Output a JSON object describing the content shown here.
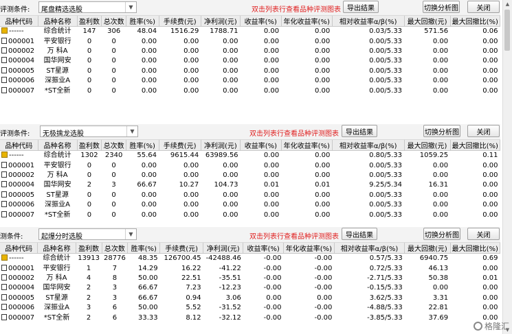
{
  "columns": [
    "品种代码",
    "品种名称",
    "盈利数",
    "总次数",
    "胜率(%)",
    "手续费(元)",
    "净利润(元)",
    "收益率(%)",
    "年化收益率(%)",
    "相对收益率α/β(%)",
    "最大回撤(元)",
    "最大回撤比(%)"
  ],
  "panels": [
    {
      "label": "评测条件:",
      "combo_value": "尾盘精选选股",
      "hint": "双击列表行查看品种评测图表",
      "export_label": "导出结果",
      "switch_label": "切换分析图",
      "close_label": "关闭",
      "rows": [
        [
          "------",
          "综合统计",
          "147",
          "306",
          "48.04",
          "1516.29",
          "1788.71",
          "0.00",
          "0.00",
          "0.03/5.33",
          "571.56",
          "0.06"
        ],
        [
          "000001",
          "平安银行",
          "0",
          "0",
          "0.00",
          "0.00",
          "0.00",
          "0.00",
          "0.00",
          "0.00/5.33",
          "0.00",
          "0.00"
        ],
        [
          "000002",
          "万 科A",
          "0",
          "0",
          "0.00",
          "0.00",
          "0.00",
          "0.00",
          "0.00",
          "0.00/5.33",
          "0.00",
          "0.00"
        ],
        [
          "000004",
          "国华网安",
          "0",
          "0",
          "0.00",
          "0.00",
          "0.00",
          "0.00",
          "0.00",
          "0.00/5.33",
          "0.00",
          "0.00"
        ],
        [
          "000005",
          "ST星源",
          "0",
          "0",
          "0.00",
          "0.00",
          "0.00",
          "0.00",
          "0.00",
          "0.00/5.33",
          "0.00",
          "0.00"
        ],
        [
          "000006",
          "深振业A",
          "0",
          "0",
          "0.00",
          "0.00",
          "0.00",
          "0.00",
          "0.00",
          "0.00/5.33",
          "0.00",
          "0.00"
        ],
        [
          "000007",
          "*ST全新",
          "0",
          "0",
          "0.00",
          "0.00",
          "0.00",
          "0.00",
          "0.00",
          "0.00/5.33",
          "0.00",
          "0.00"
        ]
      ]
    },
    {
      "label": "评测条件:",
      "combo_value": "无极擒龙选股",
      "hint": "双击列表行查看品种评测图表",
      "export_label": "导出结果",
      "switch_label": "切换分析图",
      "close_label": "关闭",
      "rows": [
        [
          "------",
          "综合统计",
          "1302",
          "2340",
          "55.64",
          "9615.44",
          "63989.56",
          "0.00",
          "0.00",
          "0.80/5.33",
          "1059.25",
          "0.11"
        ],
        [
          "000001",
          "平安银行",
          "0",
          "0",
          "0.00",
          "0.00",
          "0.00",
          "0.00",
          "0.00",
          "0.00/5.33",
          "0.00",
          "0.00"
        ],
        [
          "000002",
          "万 科A",
          "0",
          "0",
          "0.00",
          "0.00",
          "0.00",
          "0.00",
          "0.00",
          "0.00/5.33",
          "0.00",
          "0.00"
        ],
        [
          "000004",
          "国华网安",
          "2",
          "3",
          "66.67",
          "10.27",
          "104.73",
          "0.01",
          "0.01",
          "9.25/5.34",
          "16.31",
          "0.00"
        ],
        [
          "000005",
          "ST星源",
          "0",
          "0",
          "0.00",
          "0.00",
          "0.00",
          "0.00",
          "0.00",
          "0.00/5.33",
          "0.00",
          "0.00"
        ],
        [
          "000006",
          "深振业A",
          "0",
          "0",
          "0.00",
          "0.00",
          "0.00",
          "0.00",
          "0.00",
          "0.00/5.33",
          "0.00",
          "0.00"
        ],
        [
          "000007",
          "*ST全新",
          "0",
          "0",
          "0.00",
          "0.00",
          "0.00",
          "0.00",
          "0.00",
          "0.00/5.33",
          "0.00",
          "0.00"
        ]
      ]
    },
    {
      "label": "测条件:",
      "combo_value": "起爆分时选股",
      "hint": "双击列表行查看品种评测图表",
      "export_label": "导出结果",
      "switch_label": "切换分析图",
      "close_label": "关闭",
      "rows": [
        [
          "------",
          "综合统计",
          "13913",
          "28776",
          "48.35",
          "126700.45",
          "-42488.46",
          "-0.00",
          "-0.00",
          "0.57/5.33",
          "6940.75",
          "0.69"
        ],
        [
          "000001",
          "平安银行",
          "1",
          "7",
          "14.29",
          "16.22",
          "-41.22",
          "-0.00",
          "-0.00",
          "0.72/5.33",
          "46.13",
          "0.00"
        ],
        [
          "000002",
          "万 科A",
          "4",
          "8",
          "50.00",
          "22.51",
          "-35.51",
          "-0.00",
          "-0.00",
          "-2.71/5.33",
          "50.38",
          "0.01"
        ],
        [
          "000004",
          "国华网安",
          "2",
          "3",
          "66.67",
          "7.23",
          "-12.23",
          "-0.00",
          "-0.00",
          "-0.15/5.33",
          "0.00",
          "0.00"
        ],
        [
          "000005",
          "ST星源",
          "2",
          "3",
          "66.67",
          "0.94",
          "3.06",
          "0.00",
          "0.00",
          "3.62/5.33",
          "3.31",
          "0.00"
        ],
        [
          "000006",
          "深振业A",
          "3",
          "6",
          "50.00",
          "5.52",
          "-31.52",
          "-0.00",
          "-0.00",
          "-4.88/5.33",
          "22.81",
          "0.00"
        ],
        [
          "000007",
          "*ST全新",
          "2",
          "6",
          "33.33",
          "8.12",
          "-32.12",
          "-0.00",
          "-0.00",
          "-3.85/5.33",
          "37.69",
          "0.00"
        ]
      ]
    }
  ],
  "watermark": "格隆汇"
}
